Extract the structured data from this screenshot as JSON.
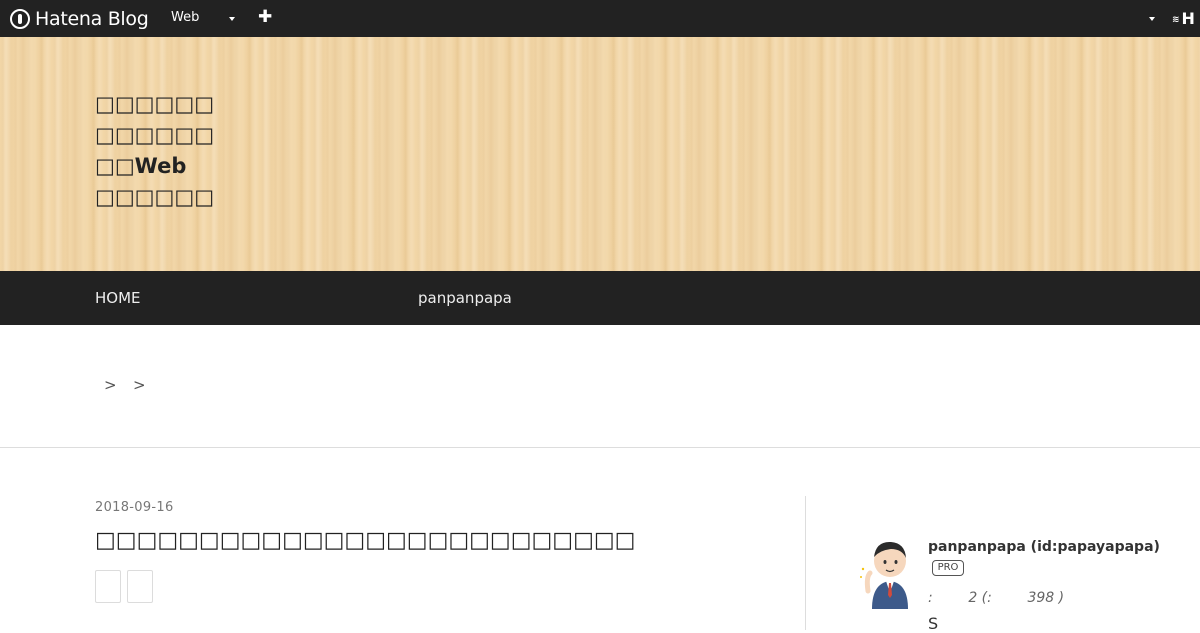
{
  "topbar": {
    "logo_text": "Hatena Blog",
    "blog_select": "Web",
    "plus_icon": "plus-icon",
    "right_mark": "H"
  },
  "header": {
    "title_lines": [
      "□□□□□□",
      "□□□□□□",
      "□□Web",
      "□□□□□□"
    ]
  },
  "nav": {
    "items": [
      "HOME",
      "panpanpapa"
    ]
  },
  "breadcrumb": {
    "separators": [
      ">",
      ">"
    ]
  },
  "entry": {
    "date": "2018-09-16",
    "title": "□□□□□□□□□□□□□□□□□□□□□□□□□□"
  },
  "sidebar": {
    "profile_name": "panpanpapa (id:papayapapa)",
    "pro_badge": "PRO",
    "stats": ":        2 (:        398 )",
    "tail": "S"
  },
  "colors": {
    "bar": "#222222",
    "wood": "#f2d6a6",
    "divider": "#dddddd"
  }
}
